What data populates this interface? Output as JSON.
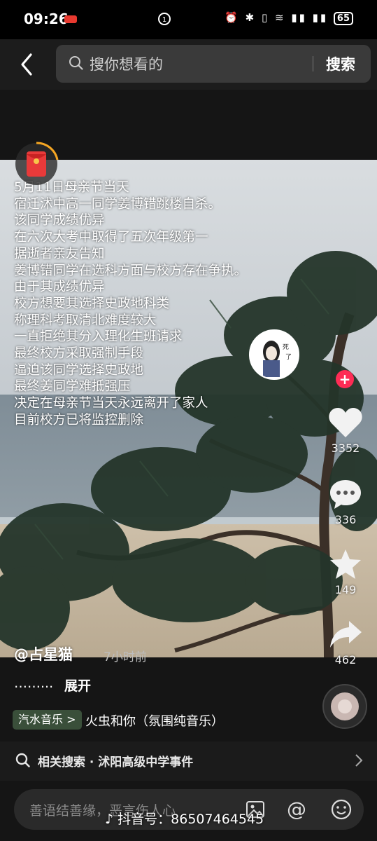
{
  "status_bar": {
    "time": "09:26",
    "center_icon": "1",
    "icons": "⏰ ✱ ▯ ≋ ▮▮ ▮▮",
    "battery": "65"
  },
  "search": {
    "placeholder": "搜你想看的",
    "button": "搜索"
  },
  "video": {
    "overlay_lines": [
      "5月11日母亲节当天",
      "宿迁沭中高一同学姜博错跳楼自杀。",
      "该同学成绩优异",
      "在六次大考中取得了五次年级第一",
      "据逝者亲友告知",
      "姜博错同学在选科方面与校方存在争执。",
      "由于其成绩优异",
      "校方想要其选择史政地科类",
      "称理科考取清北难度较大",
      "一直拒绝其分入理化生班请求",
      "最终校方采取强制手段",
      "逼迫该同学选择史政地",
      "最终姜同学难抵强压",
      "决定在母亲节当天永远离开了家人",
      "目前校方已将监控删除"
    ],
    "author": "@占星猫",
    "time_ago": "7小时前",
    "description": "……...",
    "expand": "展开",
    "music_tag": "汽水音乐 >",
    "music_title": "火虫和你（氛围纯音乐）"
  },
  "actions": {
    "likes": "3352",
    "comments": "336",
    "favorites": "149",
    "shares": "462"
  },
  "related_search": {
    "label": "相关搜索 · 沭阳高级中学事件"
  },
  "comment_bar": {
    "placeholder": "善语结善缘，恶言伤人心",
    "watermark": "抖音号：86507464545"
  },
  "colors": {
    "accent_red": "#fe2c55",
    "search_bg": "#3a3a3a"
  }
}
